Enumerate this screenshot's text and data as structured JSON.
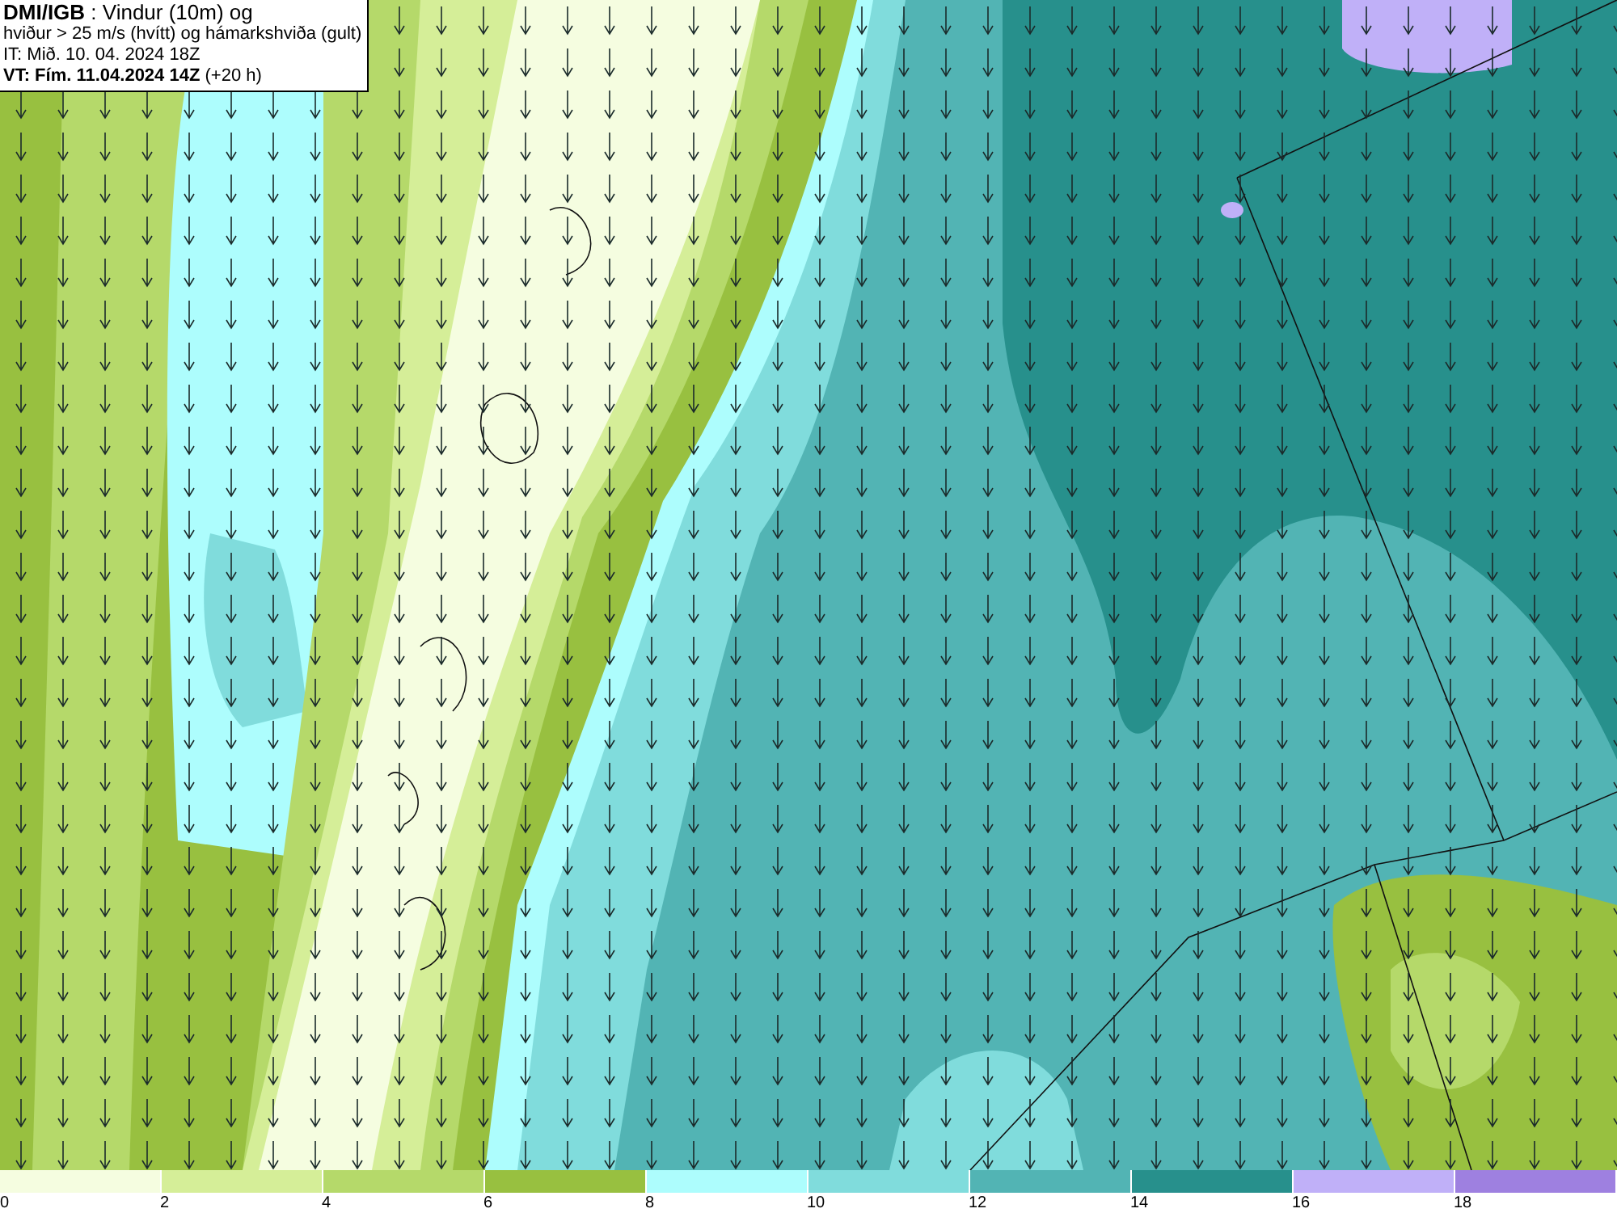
{
  "header": {
    "lines": [
      "**DMI/IGB** : Vindur (10m) og",
      "hviður > 25 m/s (hvítt) og hámarkshviða (gult)",
      "IT: Mið. 10. 04. 2024 18Z",
      "**VT: Fím. 11.04.2024 14Z** (+20 h)"
    ]
  },
  "legend": {
    "swatches": [
      {
        "label": "0",
        "color": "#f5fde0"
      },
      {
        "label": "2",
        "color": "#d5ee98"
      },
      {
        "label": "4",
        "color": "#b5d96a"
      },
      {
        "label": "6",
        "color": "#98c040"
      },
      {
        "label": "8",
        "color": "#adfdfd"
      },
      {
        "label": "10",
        "color": "#80dcdc"
      },
      {
        "label": "12",
        "color": "#52b4b4"
      },
      {
        "label": "14",
        "color": "#27908c"
      },
      {
        "label": "16",
        "color": "#c0b0f8"
      },
      {
        "label": "18",
        "color": "#9e80e0"
      }
    ]
  }
}
